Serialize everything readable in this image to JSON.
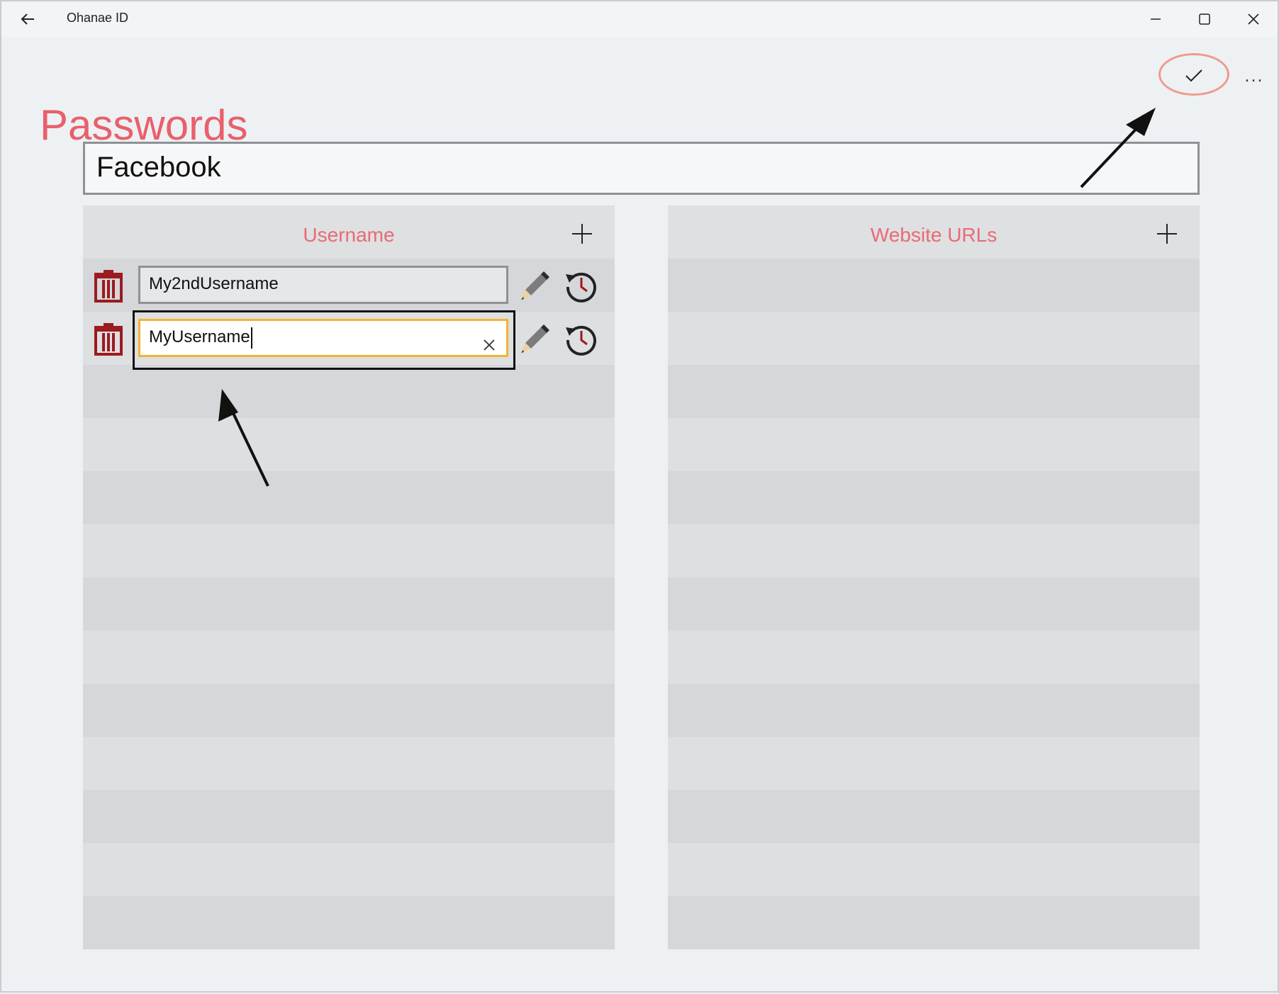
{
  "window": {
    "title": "Ohanae ID",
    "controls": [
      "minimize-icon",
      "maximize-icon",
      "close-icon"
    ]
  },
  "page": {
    "title": "Passwords",
    "more_label": "..."
  },
  "entry": {
    "title_value": "Facebook"
  },
  "username_panel": {
    "header": "Username",
    "items": [
      {
        "value": "My2ndUsername",
        "focused": false
      },
      {
        "value": "MyUsername",
        "focused": true
      }
    ]
  },
  "urls_panel": {
    "header": "Website URLs",
    "items": []
  },
  "colors": {
    "accent": "#e8606c",
    "trash": "#9b1b1f",
    "focus_border": "#f2b233",
    "annotation_ring": "#ef9a8e"
  }
}
